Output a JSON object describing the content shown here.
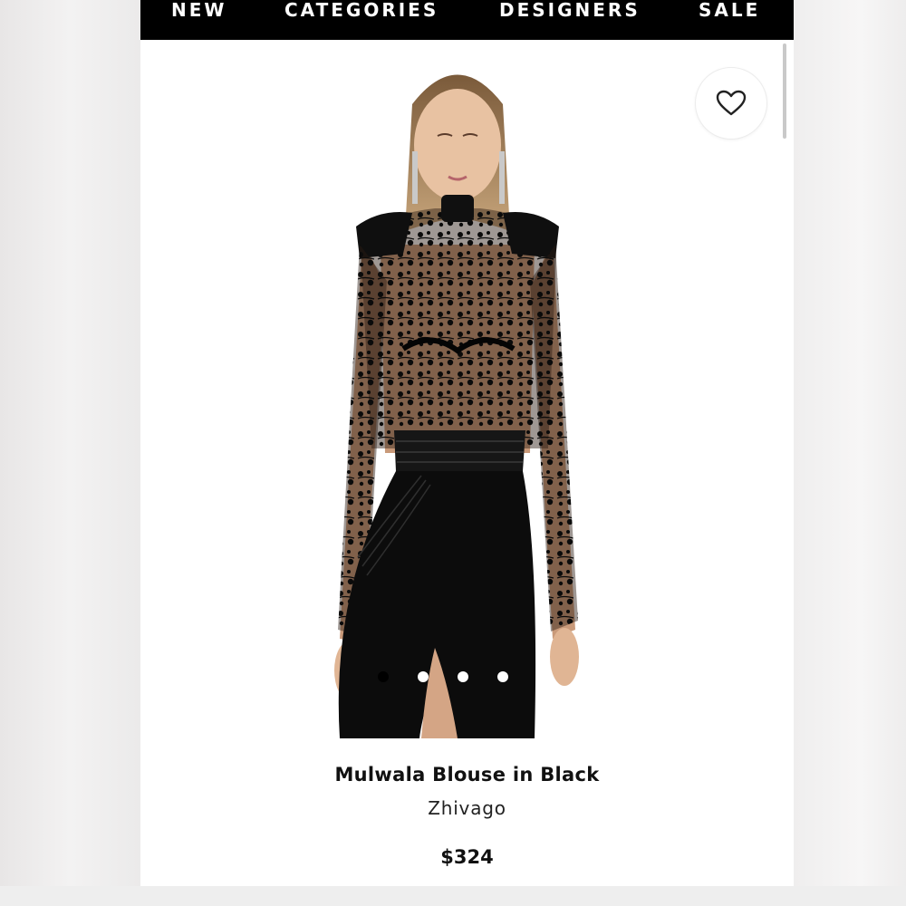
{
  "nav": {
    "items": [
      {
        "label": "NEW"
      },
      {
        "label": "CATEGORIES"
      },
      {
        "label": "DESIGNERS"
      },
      {
        "label": "SALE"
      }
    ]
  },
  "product": {
    "title": "Mulwala Blouse in Black",
    "brand": "Zhivago",
    "price": "$324",
    "image_description_icon": "model-photo",
    "carousel": {
      "total": 5,
      "active_index": 1
    }
  },
  "icons": {
    "favorite": "heart-outline-icon"
  },
  "colors": {
    "nav_bg": "#000000",
    "nav_text": "#ffffff",
    "page_bg": "#ffffff",
    "text": "#111111"
  }
}
